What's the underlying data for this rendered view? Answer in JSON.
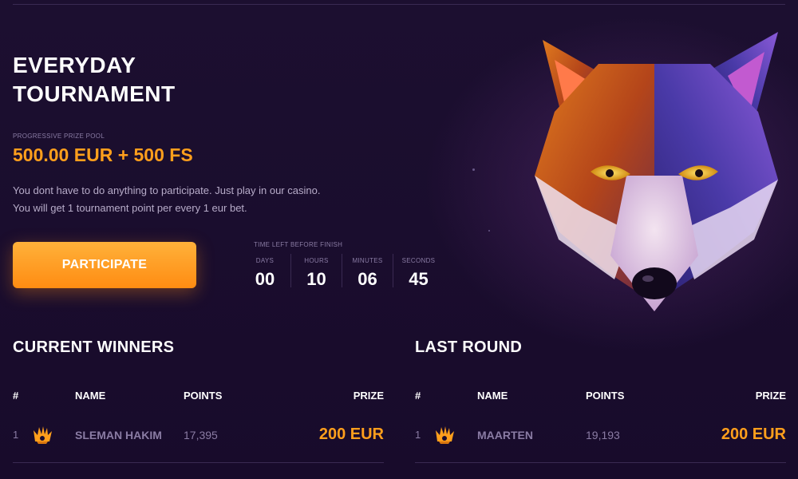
{
  "tournament": {
    "title": "EVERYDAY TOURNAMENT",
    "prize_pool_label": "PROGRESSIVE PRIZE POOL",
    "prize_pool_value": "500.00 EUR + 500 FS",
    "description_line1": "You dont have to do anything to participate. Just play in our casino.",
    "description_line2": "You will get 1 tournament point per every 1 eur bet.",
    "participate_label": "PARTICIPATE"
  },
  "timer": {
    "label": "TIME LEFT BEFORE FINISH",
    "days_label": "DAYS",
    "days": "00",
    "hours_label": "HOURS",
    "hours": "10",
    "minutes_label": "MINUTES",
    "minutes": "06",
    "seconds_label": "SECONDS",
    "seconds": "45"
  },
  "columns": {
    "num": "#",
    "name": "NAME",
    "points": "POINTS",
    "prize": "PRIZE"
  },
  "current_winners": {
    "title": "CURRENT WINNERS",
    "rows": [
      {
        "rank": "1",
        "icon": "headdress-icon",
        "name": "SLEMAN HAKIM",
        "points": "17,395",
        "prize": "200 EUR"
      }
    ]
  },
  "last_round": {
    "title": "LAST ROUND",
    "rows": [
      {
        "rank": "1",
        "icon": "headdress-icon",
        "name": "MAARTEN",
        "points": "19,193",
        "prize": "200 EUR"
      }
    ]
  },
  "colors": {
    "accent": "#ff9f1c",
    "background": "#1a0d2e",
    "muted": "#8a7ca4"
  },
  "artwork": {
    "icon": "wolf-illustration"
  }
}
